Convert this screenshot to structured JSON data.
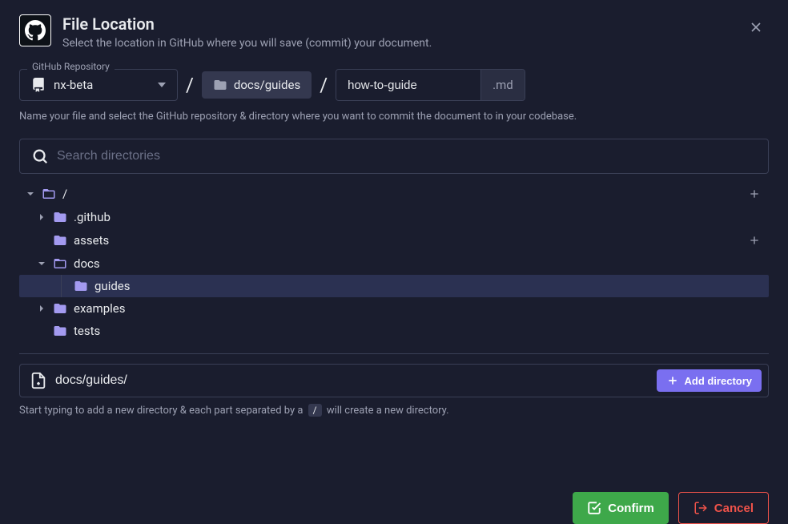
{
  "header": {
    "title": "File Location",
    "subtitle": "Select the location in GitHub where you will save (commit) your document."
  },
  "repo": {
    "label": "GitHub Repository",
    "selected": "nx-beta"
  },
  "path": {
    "directory": "docs/guides",
    "filename": "how-to-guide",
    "extension": ".md"
  },
  "helper": "Name your file and select the GitHub repository & directory where you want to commit the document to in your codebase.",
  "search": {
    "placeholder": "Search directories"
  },
  "tree": {
    "root_label": "/",
    "items": [
      {
        "name": ".github",
        "expanded": false,
        "has_children": true
      },
      {
        "name": "assets",
        "expanded": false,
        "has_children": false
      },
      {
        "name": "docs",
        "expanded": true,
        "has_children": true,
        "children": [
          {
            "name": "guides",
            "selected": true
          }
        ]
      },
      {
        "name": "examples",
        "expanded": false,
        "has_children": true
      },
      {
        "name": "tests",
        "expanded": false,
        "has_children": false
      }
    ]
  },
  "newDirectory": {
    "value": "docs/guides/",
    "button": "Add directory",
    "help_prefix": "Start typing to add a new directory & each part separated by a ",
    "slash_chip": "/",
    "help_suffix": " will create a new directory."
  },
  "footer": {
    "confirm": "Confirm",
    "cancel": "Cancel"
  }
}
